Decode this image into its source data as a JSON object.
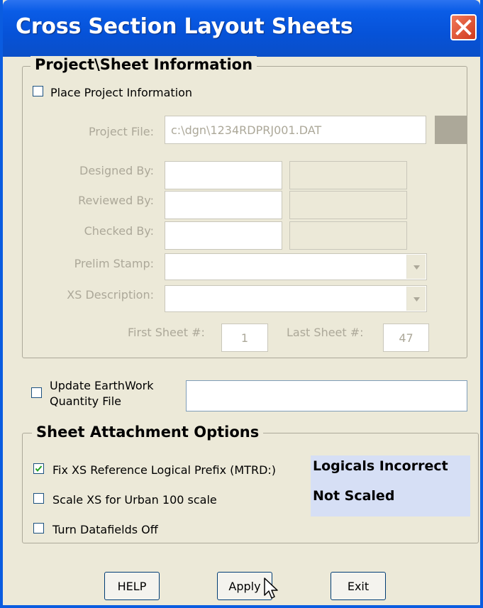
{
  "window": {
    "title": "Cross Section Layout Sheets",
    "close_icon": "close-icon"
  },
  "project_group": {
    "legend": "Project\\Sheet Information",
    "place_project_info": {
      "label": "Place Project Information",
      "checked": false
    },
    "project_file": {
      "label": "Project File:",
      "value": "c:\\dgn\\1234RDPRJ001.DAT"
    },
    "designed_by": {
      "label": "Designed By:",
      "value1": "",
      "value2": ""
    },
    "reviewed_by": {
      "label": "Reviewed By:",
      "value1": "",
      "value2": ""
    },
    "checked_by": {
      "label": "Checked By:",
      "value1": "",
      "value2": ""
    },
    "prelim_stamp": {
      "label": "Prelim Stamp:",
      "value": ""
    },
    "xs_description": {
      "label": "XS Description:",
      "value": ""
    },
    "first_sheet": {
      "label": "First Sheet #:",
      "value": "1"
    },
    "last_sheet": {
      "label": "Last Sheet #:",
      "value": "47"
    }
  },
  "earthwork": {
    "label_line1": "Update EarthWork",
    "label_line2": "Quantity File",
    "checked": false,
    "value": ""
  },
  "attachment_group": {
    "legend": "Sheet Attachment Options",
    "fix_prefix": {
      "label": "Fix XS Reference Logical Prefix (MTRD:)",
      "checked": true
    },
    "scale_urban": {
      "label": "Scale XS for Urban 100 scale",
      "checked": false
    },
    "turn_datafields_off": {
      "label": "Turn Datafields Off",
      "checked": false
    },
    "status_logicals": "Logicals Incorrect",
    "status_scaled": "Not Scaled"
  },
  "buttons": {
    "help": "HELP",
    "apply": "Apply",
    "exit": "Exit"
  },
  "colors": {
    "titlebar": "#0a5ce6",
    "face": "#ece9d8",
    "disabled_text": "#aca899",
    "status_bg": "#d6dff5"
  }
}
